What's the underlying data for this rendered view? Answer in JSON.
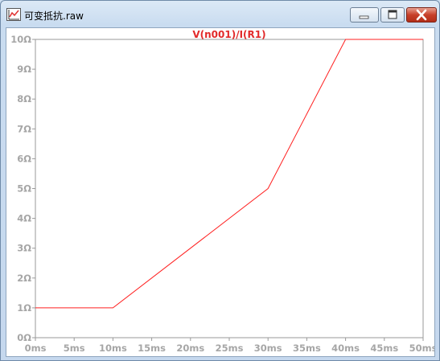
{
  "window": {
    "title": "可变抵抗.raw",
    "controls": [
      "minimize-icon",
      "maximize-icon",
      "close-icon"
    ]
  },
  "colors": {
    "trace": "#ff2020",
    "axis_text": "#a6a6a6",
    "plot_border": "#9a9a9a"
  },
  "chart_data": {
    "type": "line",
    "title": "V(n001)/I(R1)",
    "xlabel": "",
    "ylabel": "",
    "xlim": [
      0,
      50
    ],
    "ylim": [
      0,
      10
    ],
    "x_ticks": [
      "0ms",
      "5ms",
      "10ms",
      "15ms",
      "20ms",
      "25ms",
      "30ms",
      "35ms",
      "40ms",
      "45ms",
      "50ms"
    ],
    "y_ticks": [
      "0Ω",
      "1Ω",
      "2Ω",
      "3Ω",
      "4Ω",
      "5Ω",
      "6Ω",
      "7Ω",
      "8Ω",
      "9Ω",
      "10Ω"
    ],
    "grid": false,
    "series": [
      {
        "name": "V(n001)/I(R1)",
        "x": [
          0,
          10,
          30,
          40,
          50
        ],
        "y": [
          1,
          1,
          5,
          10,
          10
        ]
      }
    ]
  }
}
